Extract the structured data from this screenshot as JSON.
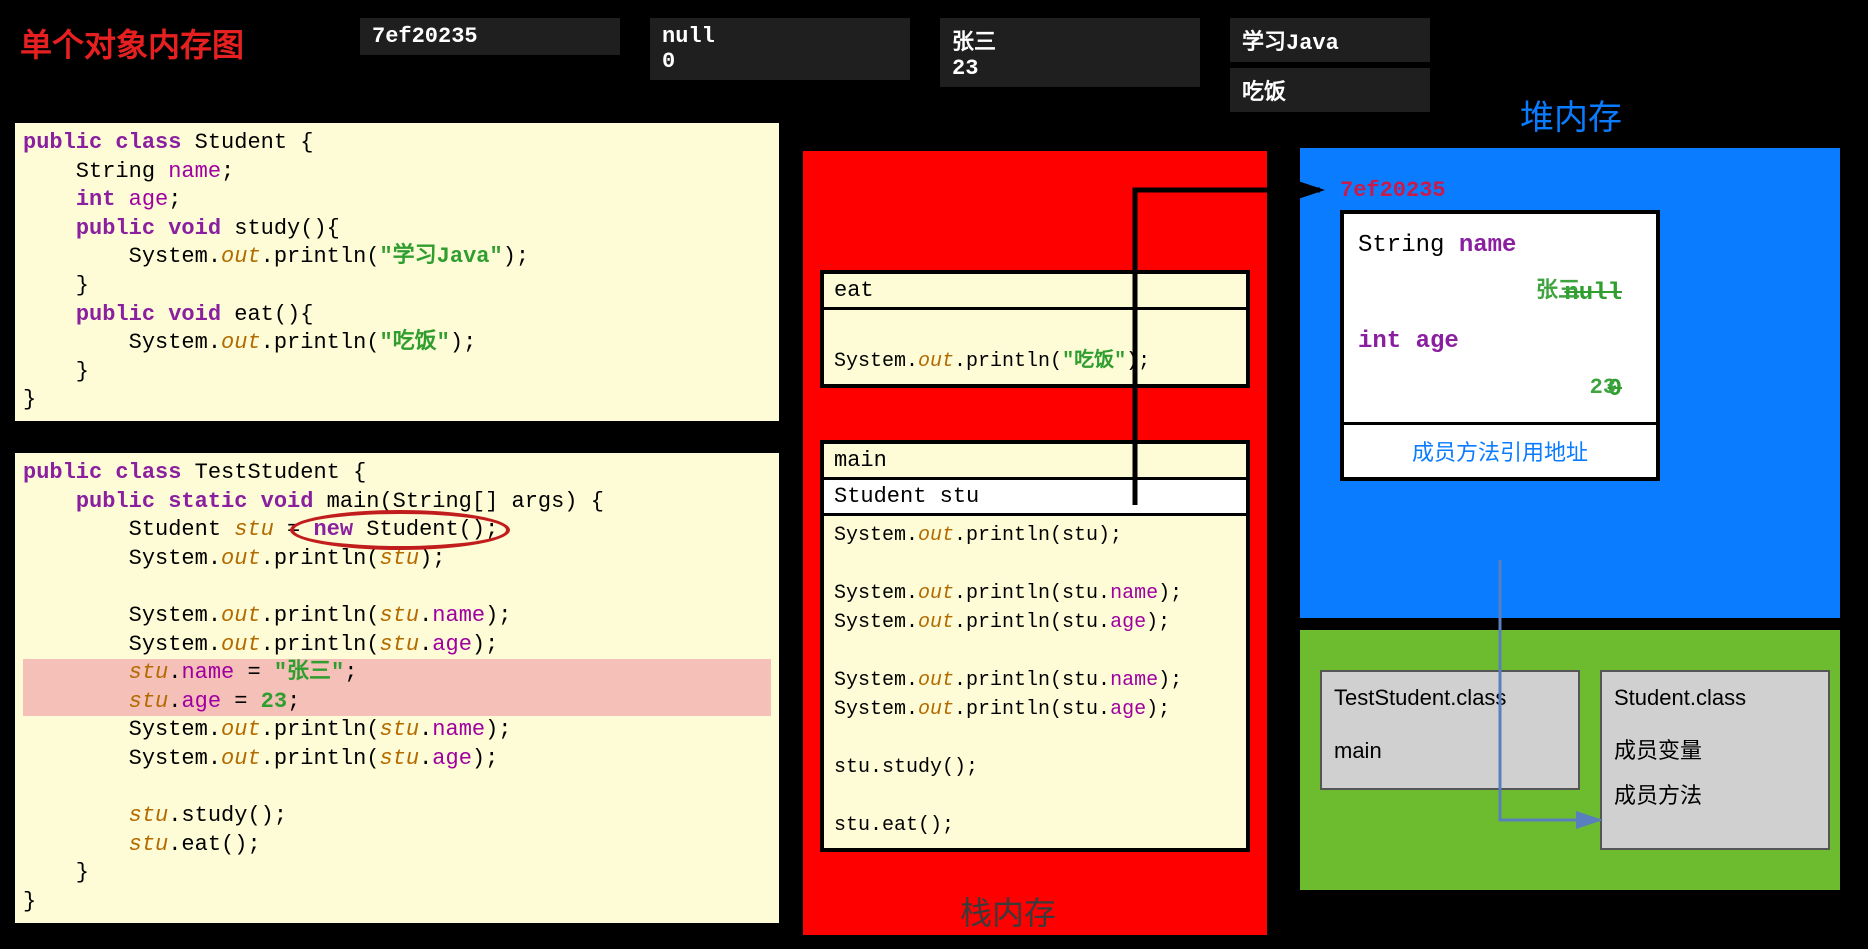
{
  "title": "单个对象内存图",
  "top_boxes": {
    "b1": "7ef20235",
    "b2a": "null",
    "b2b": "0",
    "b3a": "张三",
    "b3b": "23",
    "b4a": "学习Java",
    "b4b": "吃饭"
  },
  "code1": {
    "l1_kw": "public class",
    "l1_name": " Student {",
    "l2": "    String ",
    "l2f": "name",
    "l2e": ";",
    "l3a": "    ",
    "l3kw": "int",
    "l3sp": " ",
    "l3f": "age",
    "l3e": ";",
    "l4a": "    ",
    "l4kw": "public void",
    "l4n": " study(){",
    "l5a": "        System.",
    "l5o": "out",
    "l5b": ".println(",
    "l5s": "\"学习Java\"",
    "l5e": ");",
    "l6": "    }",
    "l7a": "    ",
    "l7kw": "public void",
    "l7n": " eat(){",
    "l8a": "        System.",
    "l8o": "out",
    "l8b": ".println(",
    "l8s": "\"吃饭\"",
    "l8e": ");",
    "l9": "    }",
    "l10": "}"
  },
  "code2": {
    "l1kw": "public class",
    "l1n": " TestStudent {",
    "l2a": "    ",
    "l2kw": "public static void",
    "l2n": " main(String[] args) {",
    "l3a": "        Student ",
    "l3v": "stu",
    "l3b": " = ",
    "l3kw": "new",
    "l3c": " Student();",
    "l4a": "        System.",
    "l4o": "out",
    "l4b": ".println(",
    "l4v": "stu",
    "l4e": ");",
    "blank": " ",
    "l5a": "        System.",
    "l5o": "out",
    "l5b": ".println(",
    "l5v": "stu",
    "l5d": ".",
    "l5f": "name",
    "l5e": ");",
    "l6a": "        System.",
    "l6o": "out",
    "l6b": ".println(",
    "l6v": "stu",
    "l6d": ".",
    "l6f": "age",
    "l6e": ");",
    "l7a": "        ",
    "l7v": "stu",
    "l7d": ".",
    "l7f": "name",
    "l7b": " = ",
    "l7s": "\"张三\"",
    "l7e": ";",
    "l8a": "        ",
    "l8v": "stu",
    "l8d": ".",
    "l8f": "age",
    "l8b": " = ",
    "l8n": "23",
    "l8e": ";",
    "l9a": "        System.",
    "l9o": "out",
    "l9b": ".println(",
    "l9v": "stu",
    "l9d": ".",
    "l9f": "name",
    "l9e": ");",
    "l10a": "        System.",
    "l10o": "out",
    "l10b": ".println(",
    "l10v": "stu",
    "l10d": ".",
    "l10f": "age",
    "l10e": ");",
    "l11a": "        ",
    "l11v": "stu",
    "l11b": ".study();",
    "l12a": "        ",
    "l12v": "stu",
    "l12b": ".eat();",
    "l13": "    }",
    "l14": "}"
  },
  "stack": {
    "label": "栈内存",
    "eat_header": "eat",
    "eat_body_a": "System.",
    "eat_body_o": "out",
    "eat_body_b": ".println(",
    "eat_body_s": "\"吃饭\"",
    "eat_body_e": ");",
    "main_header": "main",
    "main_row": "Student stu",
    "m1a": "System.",
    "m1o": "out",
    "m1b": ".println(stu);",
    "m2a": "System.",
    "m2o": "out",
    "m2b": ".println(stu.",
    "m2f": "name",
    "m2e": ");",
    "m3a": "System.",
    "m3o": "out",
    "m3b": ".println(stu.",
    "m3f": "age",
    "m3e": ");",
    "m4a": "System.",
    "m4o": "out",
    "m4b": ".println(stu.",
    "m4f": "name",
    "m4e": ");",
    "m5a": "System.",
    "m5o": "out",
    "m5b": ".println(stu.",
    "m5f": "age",
    "m5e": ");",
    "m6": "stu.study();",
    "m7": "stu.eat();"
  },
  "heap": {
    "title": "堆内存",
    "addr": "7ef20235",
    "f1t": "String",
    "f1n": " name",
    "f1v_old": "null",
    "f1v_new": "张三",
    "f2t": "int",
    "f2n": " age",
    "f2v_old": "0",
    "f2v_new": "23",
    "footer": "成员方法引用地址"
  },
  "method_area": {
    "c1_l1": "TestStudent.class",
    "c1_l2": "main",
    "c2_l1": "Student.class",
    "c2_l2": "成员变量",
    "c2_l3": "成员方法"
  }
}
